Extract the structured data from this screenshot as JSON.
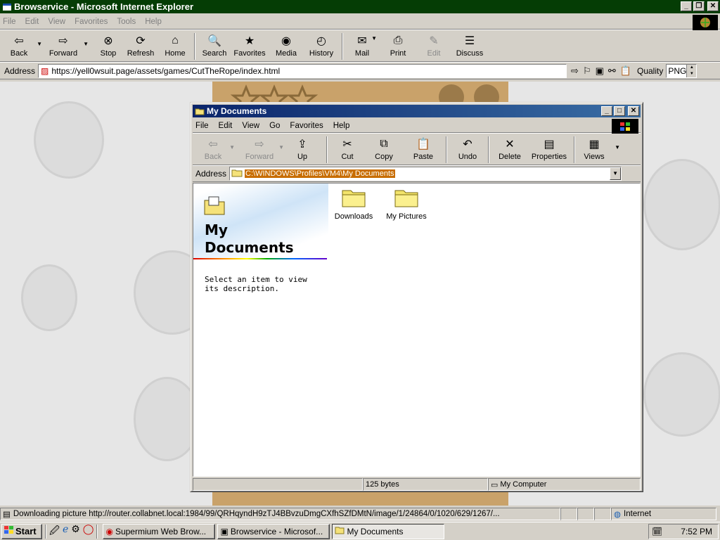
{
  "ie": {
    "title": "Browservice - Microsoft Internet Explorer",
    "menu": [
      "File",
      "Edit",
      "View",
      "Favorites",
      "Tools",
      "Help"
    ],
    "toolbar": [
      {
        "label": "Back",
        "icon": "back-arrow-icon",
        "drop": true
      },
      {
        "label": "Forward",
        "icon": "forward-arrow-icon",
        "drop": true
      },
      {
        "label": "Stop",
        "icon": "stop-icon"
      },
      {
        "label": "Refresh",
        "icon": "refresh-icon"
      },
      {
        "label": "Home",
        "icon": "home-icon"
      },
      {
        "label": "Search",
        "icon": "search-icon"
      },
      {
        "label": "Favorites",
        "icon": "favorites-icon"
      },
      {
        "label": "Media",
        "icon": "media-icon"
      },
      {
        "label": "History",
        "icon": "history-icon"
      },
      {
        "label": "Mail",
        "icon": "mail-icon",
        "drop": true
      },
      {
        "label": "Print",
        "icon": "print-icon"
      },
      {
        "label": "Edit",
        "icon": "edit-icon"
      },
      {
        "label": "Discuss",
        "icon": "discuss-icon"
      }
    ],
    "address_label": "Address",
    "url": "https://yell0wsuit.page/assets/games/CutTheRope/index.html",
    "quality_label": "Quality",
    "quality_value": "PNG",
    "status_text": "Downloading picture http://router.collabnet.local:1984/99/QRHqyndH9zTJ4BBvzuDmgCXfhSZfDMtN/image/1/24864/0/1020/629/1267/...",
    "zone": "Internet"
  },
  "explorer": {
    "title": "My Documents",
    "menu": [
      "File",
      "Edit",
      "View",
      "Go",
      "Favorites",
      "Help"
    ],
    "toolbar": [
      {
        "label": "Back",
        "icon": "back-arrow-icon",
        "drop": true,
        "disabled": true
      },
      {
        "label": "Forward",
        "icon": "forward-arrow-icon",
        "drop": true,
        "disabled": true
      },
      {
        "label": "Up",
        "icon": "up-folder-icon"
      },
      {
        "label": "Cut",
        "icon": "scissors-icon"
      },
      {
        "label": "Copy",
        "icon": "copy-icon"
      },
      {
        "label": "Paste",
        "icon": "paste-icon"
      },
      {
        "label": "Undo",
        "icon": "undo-icon"
      },
      {
        "label": "Delete",
        "icon": "delete-icon"
      },
      {
        "label": "Properties",
        "icon": "properties-icon"
      },
      {
        "label": "Views",
        "icon": "views-icon",
        "drop": true
      }
    ],
    "address_label": "Address",
    "path": "C:\\WINDOWS\\Profiles\\VM4\\My Documents",
    "panel_title_1": "My",
    "panel_title_2": "Documents",
    "panel_desc": "Select an item to view its description.",
    "folders": [
      "Downloads",
      "My Pictures"
    ],
    "status_size": "125 bytes",
    "status_location": "My Computer"
  },
  "taskbar": {
    "start": "Start",
    "tasks": [
      "Supermium Web Brow...",
      "Browservice - Microsof...",
      "My Documents"
    ],
    "clock": "7:52 PM"
  },
  "colors": {
    "ie_title": "#053d05",
    "explorer_title": "#0a246a",
    "selection": "#c86d00"
  }
}
